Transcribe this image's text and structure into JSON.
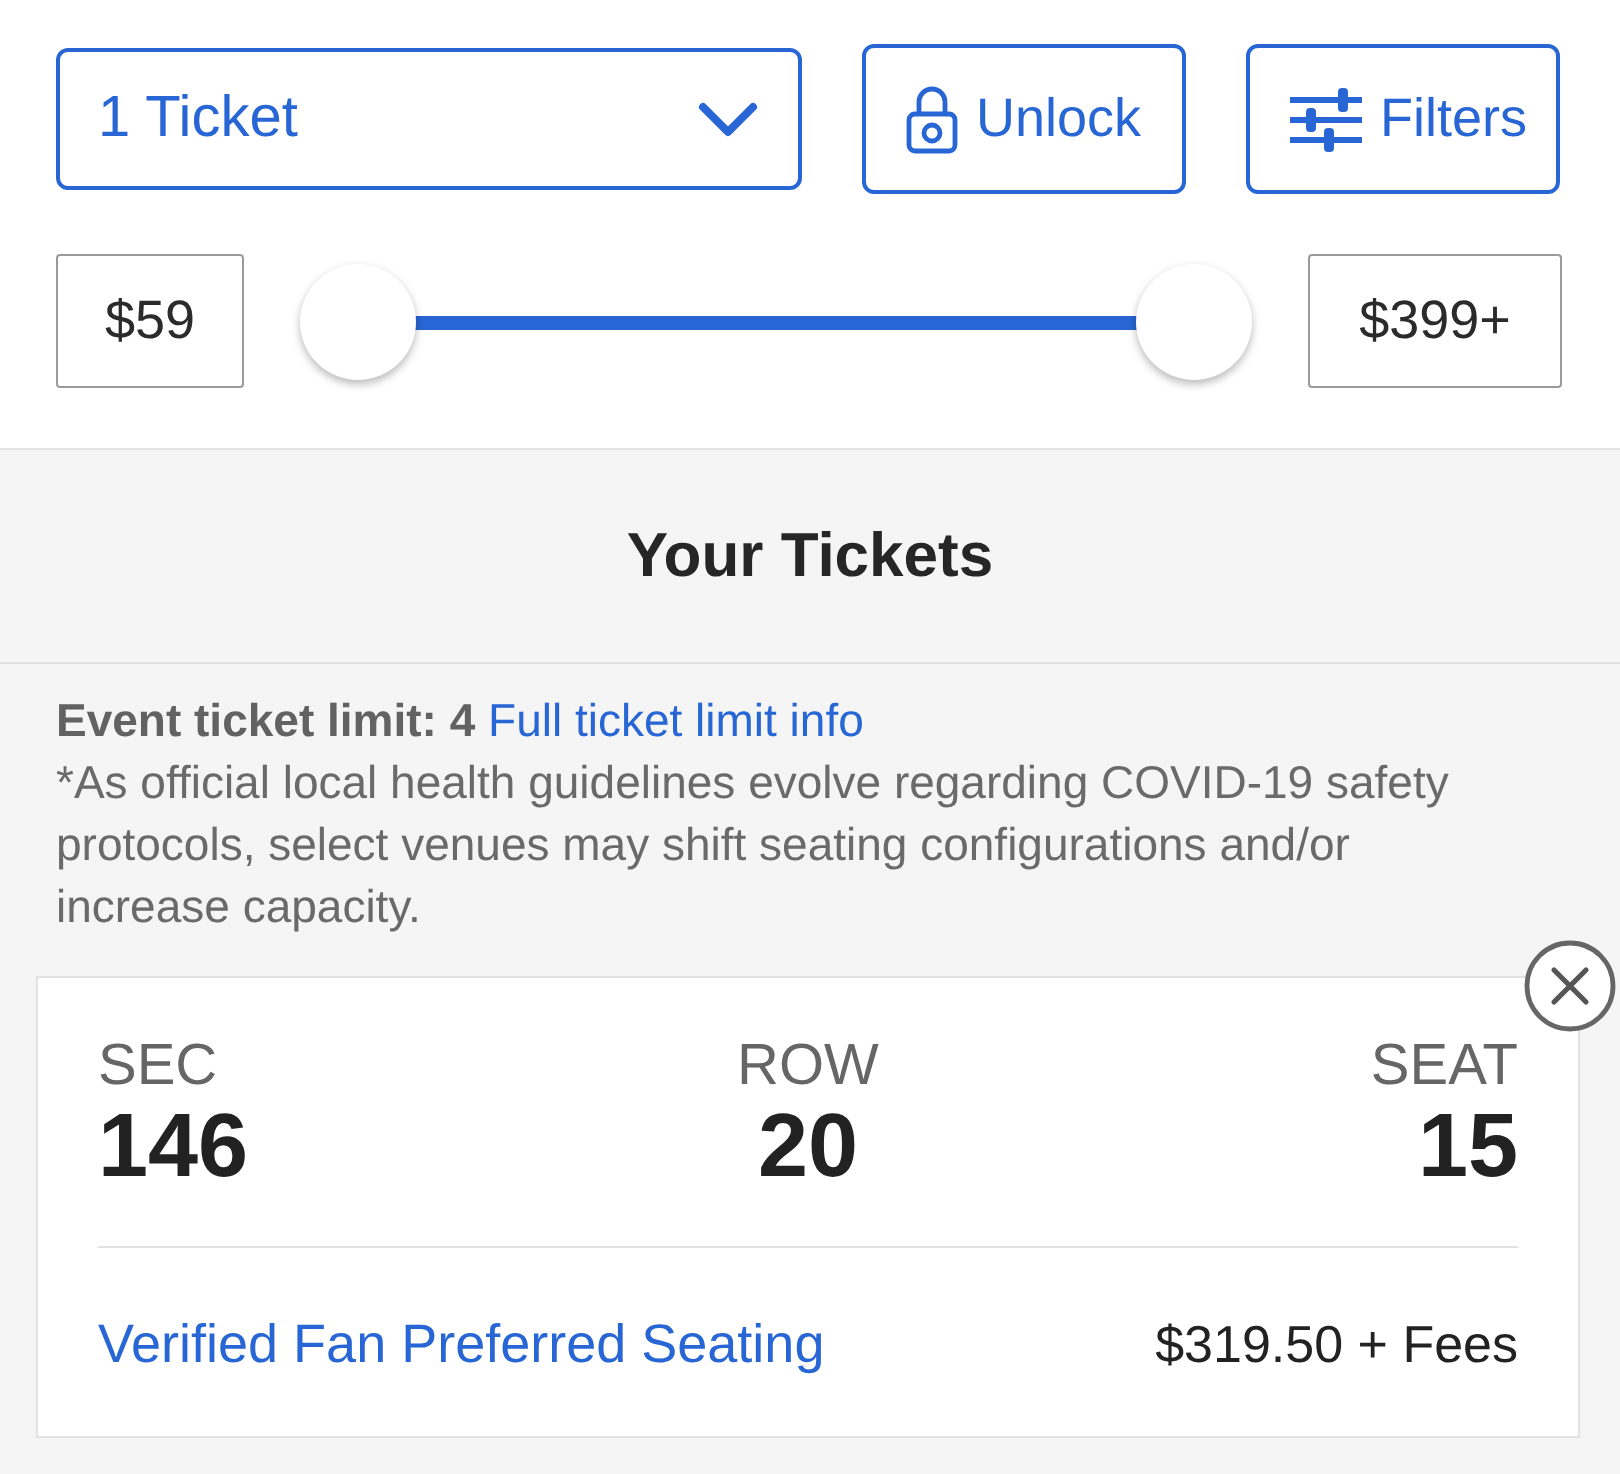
{
  "ticket_select": {
    "value": "1 Ticket"
  },
  "buttons": [
    {
      "kind": "unlock",
      "label": "Unlock"
    },
    {
      "kind": "filters",
      "label": "Filters"
    }
  ],
  "price_range": {
    "min_value": "$59",
    "max_value": "$399+",
    "thumbs": [
      {
        "level": 0
      },
      {
        "level": 1
      }
    ]
  },
  "section": {
    "title": "Your Tickets"
  },
  "notice": {
    "limit": "Event ticket limit: 4",
    "link": "Full ticket limit info",
    "disclaimer": "*As official local health guidelines evolve regarding COVID-19 safety protocols, select venues may shift seating configurations and/or increase capacity."
  },
  "ticket": {
    "seat_info": [
      {
        "label": "SEC",
        "value": "146"
      },
      {
        "label": "ROW",
        "value": "20"
      },
      {
        "label": "SEAT",
        "value": "15"
      }
    ],
    "offer": "Verified Fan Preferred Seating",
    "price": "$319.50 + Fees"
  }
}
